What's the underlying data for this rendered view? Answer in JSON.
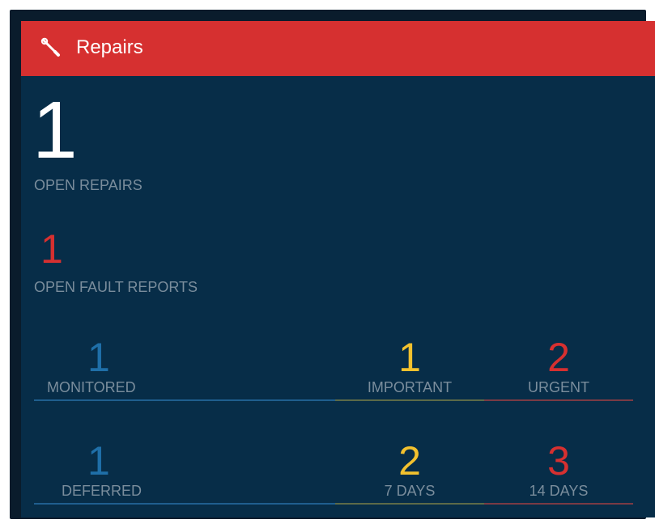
{
  "widget": {
    "title": "Repairs",
    "icon": "wrench-icon",
    "accent_color": "#d63030",
    "background_color": "#072d48"
  },
  "open_repairs": {
    "value": "1",
    "label": "OPEN REPAIRS"
  },
  "open_fault_reports": {
    "value": "1",
    "label": "OPEN FAULT REPORTS"
  },
  "categories": {
    "monitored": {
      "value": "1",
      "label": "MONITORED",
      "color": "#1f6fa8"
    },
    "important": {
      "value": "1",
      "label": "IMPORTANT",
      "color": "#f2c12e"
    },
    "urgent": {
      "value": "2",
      "label": "URGENT",
      "color": "#d63030"
    }
  },
  "schedule": {
    "deferred": {
      "value": "1",
      "label": "DEFERRED",
      "color": "#1f6fa8"
    },
    "seven_days": {
      "value": "2",
      "label": "7 DAYS",
      "color": "#f2c12e"
    },
    "fourteen_days": {
      "value": "3",
      "label": "14 DAYS",
      "color": "#d63030"
    }
  }
}
